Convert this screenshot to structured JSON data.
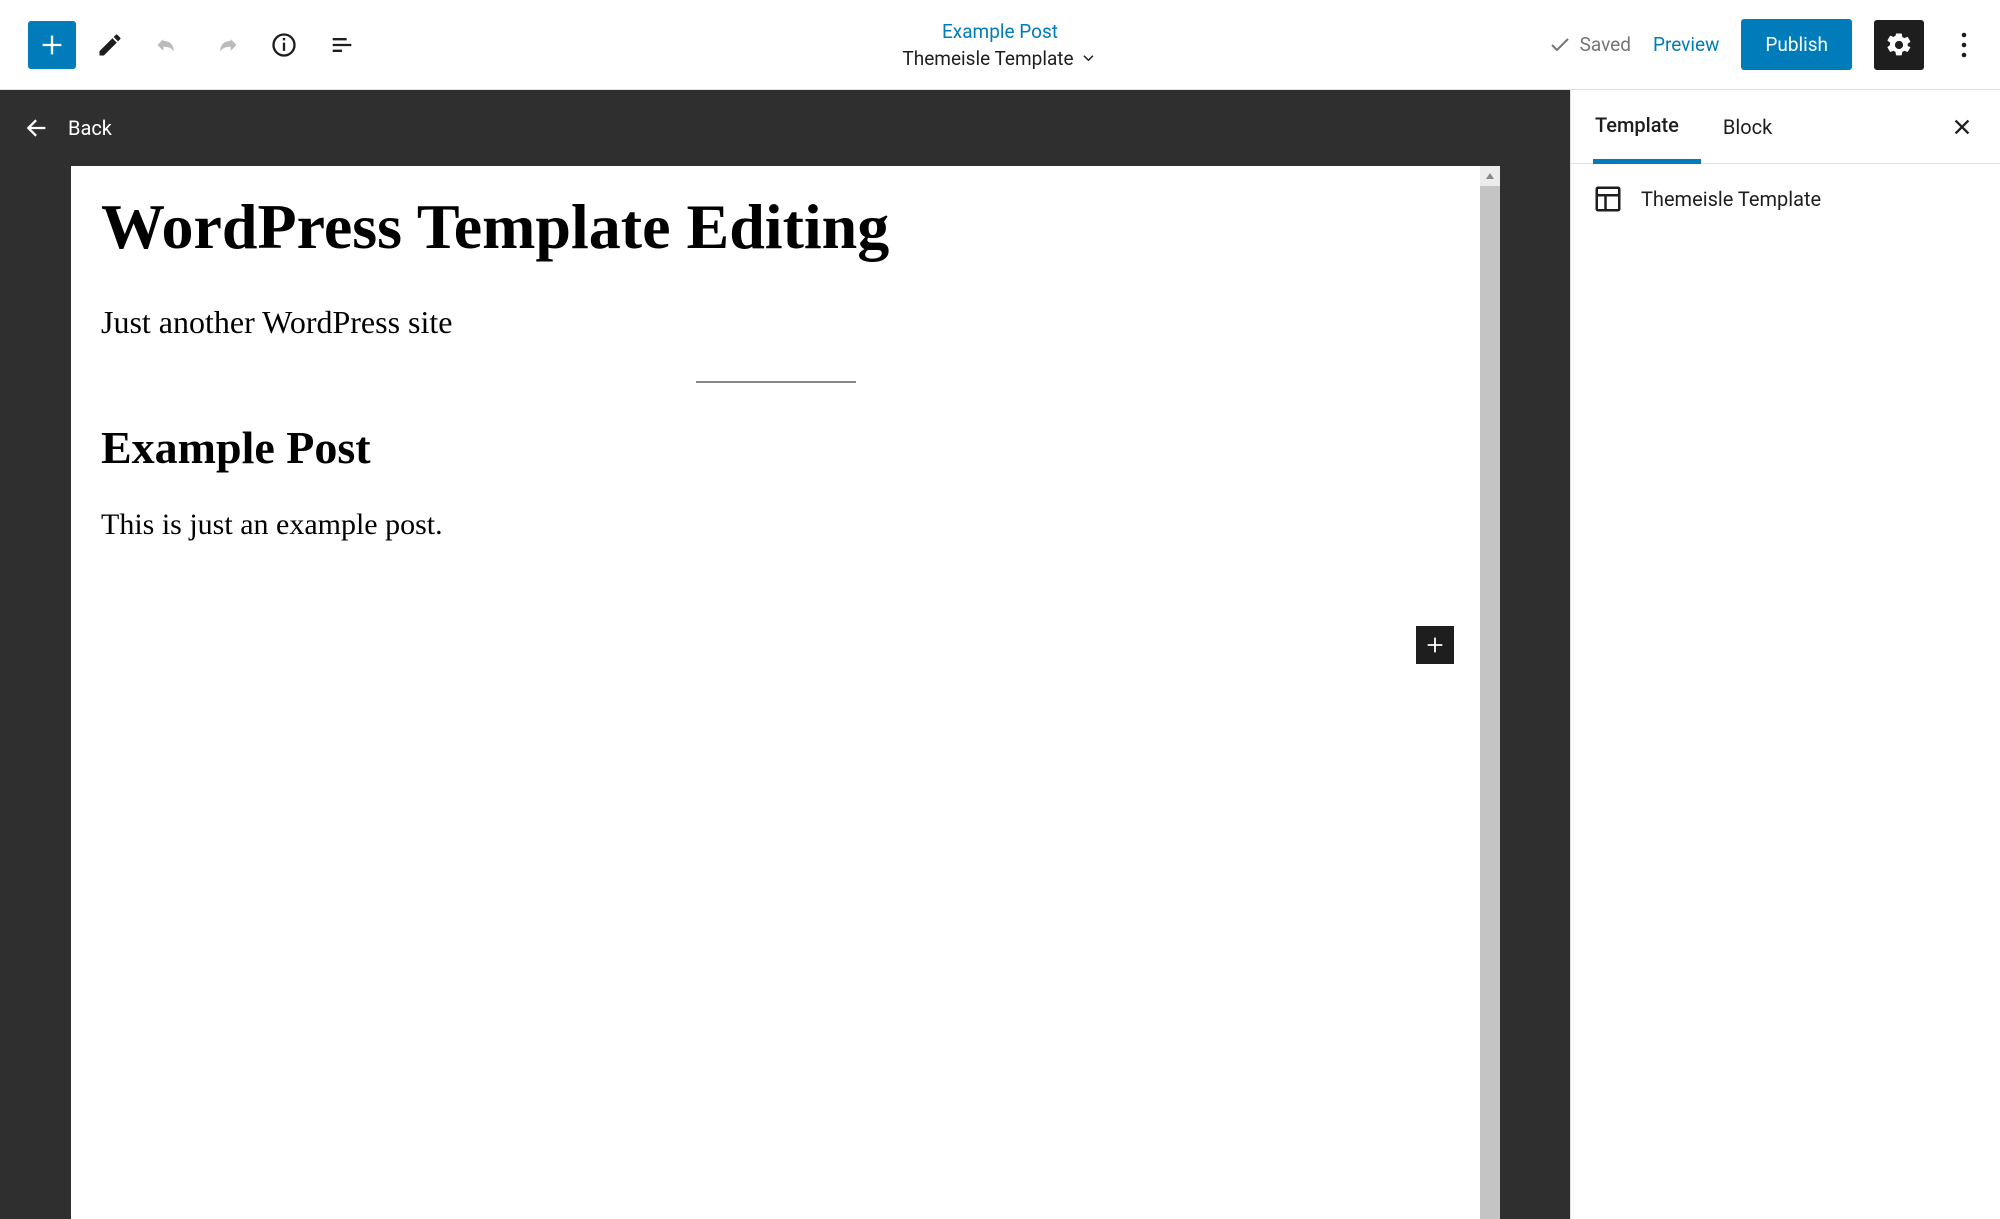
{
  "header": {
    "doc_title": "Example Post",
    "template_name": "Themeisle Template",
    "saved_label": "Saved",
    "preview_label": "Preview",
    "publish_label": "Publish"
  },
  "back_label": "Back",
  "canvas": {
    "site_title": "WordPress Template Editing",
    "site_tagline": "Just another WordPress site",
    "post_title": "Example Post",
    "post_body": "This is just an example post."
  },
  "sidebar": {
    "tabs": [
      "Template",
      "Block"
    ],
    "template_name": "Themeisle Template"
  }
}
